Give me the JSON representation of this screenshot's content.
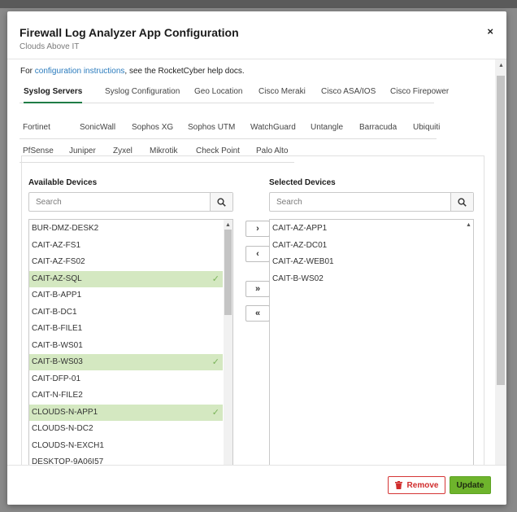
{
  "modal": {
    "title": "Firewall Log Analyzer App Configuration",
    "subtitle": "Clouds Above IT",
    "close": "×"
  },
  "help": {
    "prefix": "For ",
    "link": "configuration instructions",
    "suffix": ", see the RocketCyber help docs."
  },
  "tabs": {
    "row1": [
      "Syslog Servers",
      "Syslog Configuration",
      "Geo Location",
      "Cisco Meraki",
      "Cisco ASA/IOS",
      "Cisco Firepower"
    ],
    "row2": [
      "Fortinet",
      "SonicWall",
      "Sophos XG",
      "Sophos UTM",
      "WatchGuard",
      "Untangle",
      "Barracuda",
      "Ubiquiti"
    ],
    "row3": [
      "PfSense",
      "Juniper",
      "Zyxel",
      "Mikrotik",
      "Check Point",
      "Palo Alto"
    ],
    "active": "Syslog Servers"
  },
  "available": {
    "title": "Available Devices",
    "search_placeholder": "Search",
    "items": [
      {
        "name": "BUR-DMZ-DESK2",
        "selected": false
      },
      {
        "name": "CAIT-AZ-FS1",
        "selected": false
      },
      {
        "name": "CAIT-AZ-FS02",
        "selected": false
      },
      {
        "name": "CAIT-AZ-SQL",
        "selected": true
      },
      {
        "name": "CAIT-B-APP1",
        "selected": false
      },
      {
        "name": "CAIT-B-DC1",
        "selected": false
      },
      {
        "name": "CAIT-B-FILE1",
        "selected": false
      },
      {
        "name": "CAIT-B-WS01",
        "selected": false
      },
      {
        "name": "CAIT-B-WS03",
        "selected": true
      },
      {
        "name": "CAIT-DFP-01",
        "selected": false
      },
      {
        "name": "CAIT-N-FILE2",
        "selected": false
      },
      {
        "name": "CLOUDS-N-APP1",
        "selected": true
      },
      {
        "name": "CLOUDS-N-DC2",
        "selected": false
      },
      {
        "name": "CLOUDS-N-EXCH1",
        "selected": false
      },
      {
        "name": "DESKTOP-9A06I57",
        "selected": false
      }
    ]
  },
  "selected": {
    "title": "Selected Devices",
    "search_placeholder": "Search",
    "items": [
      "CAIT-AZ-APP1",
      "CAIT-AZ-DC01",
      "CAIT-AZ-WEB01",
      "CAIT-B-WS02"
    ]
  },
  "move_buttons": {
    "add": "›",
    "remove": "‹",
    "add_all": "»",
    "remove_all": "«"
  },
  "footer": {
    "remove_label": "Remove",
    "update_label": "Update"
  },
  "colors": {
    "accent_green": "#6eb42c",
    "tab_underline": "#1f7d46",
    "selected_row": "#d4e8c1",
    "danger": "#d02c2c",
    "link": "#2a7bbd"
  },
  "icons": {
    "search": "search-icon",
    "trash": "trash-icon",
    "check": "check-icon"
  }
}
